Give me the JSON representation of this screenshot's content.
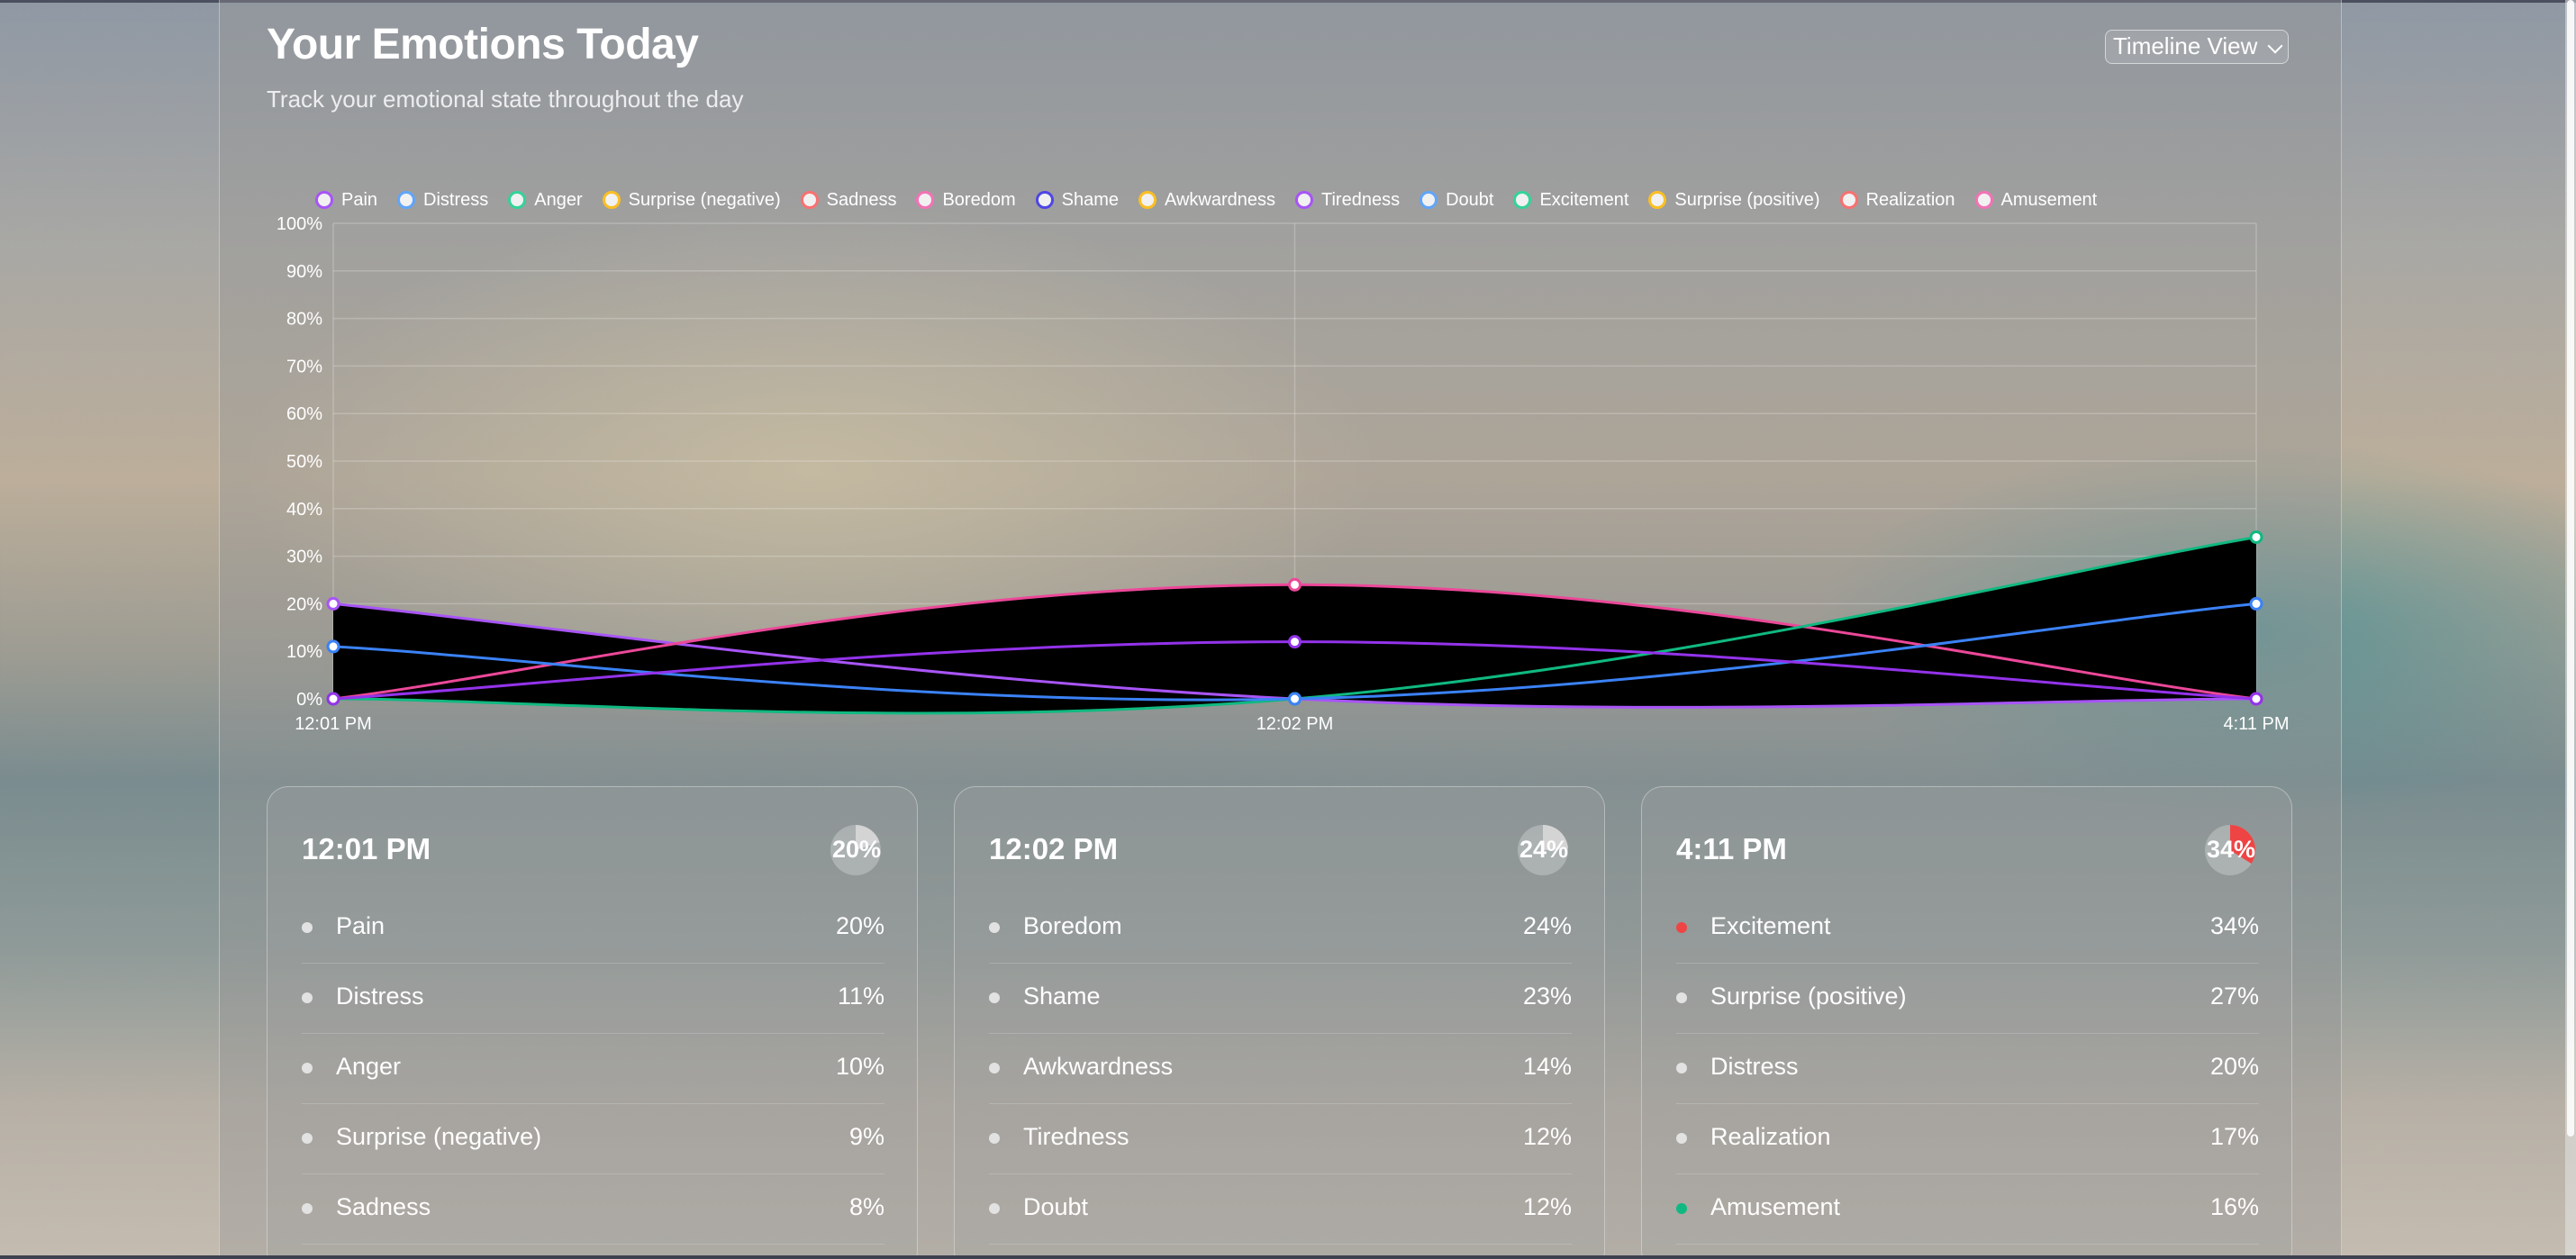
{
  "header": {
    "title": "Your Emotions Today",
    "subtitle": "Track your emotional state throughout the day",
    "view_select": "Timeline View"
  },
  "legend": [
    {
      "label": "Pain",
      "color": "#a855f7"
    },
    {
      "label": "Distress",
      "color": "#60a5fa"
    },
    {
      "label": "Anger",
      "color": "#34d399"
    },
    {
      "label": "Surprise (negative)",
      "color": "#fbbf24"
    },
    {
      "label": "Sadness",
      "color": "#f87171"
    },
    {
      "label": "Boredom",
      "color": "#f472b6"
    },
    {
      "label": "Shame",
      "color": "#4f46e5"
    },
    {
      "label": "Awkwardness",
      "color": "#fbbf24"
    },
    {
      "label": "Tiredness",
      "color": "#a855f7"
    },
    {
      "label": "Doubt",
      "color": "#60a5fa"
    },
    {
      "label": "Excitement",
      "color": "#34d399"
    },
    {
      "label": "Surprise (positive)",
      "color": "#fbbf24"
    },
    {
      "label": "Realization",
      "color": "#f87171"
    },
    {
      "label": "Amusement",
      "color": "#f472b6"
    }
  ],
  "chart_data": {
    "type": "area",
    "x": [
      "12:01 PM",
      "12:02 PM",
      "4:11 PM"
    ],
    "ylim": [
      0,
      100
    ],
    "yticks": [
      "0%",
      "10%",
      "20%",
      "30%",
      "40%",
      "50%",
      "60%",
      "70%",
      "80%",
      "90%",
      "100%"
    ],
    "grid": true,
    "legend": "top",
    "series": [
      {
        "name": "Pain",
        "values": [
          20,
          0,
          0
        ],
        "color": "#a855f7"
      },
      {
        "name": "Boredom",
        "values": [
          0,
          24,
          0
        ],
        "color": "#ec4899"
      },
      {
        "name": "Excitement",
        "values": [
          0,
          0,
          34
        ],
        "color": "#10b981"
      },
      {
        "name": "Distress",
        "values": [
          11,
          0,
          20
        ],
        "color": "#3b82f6"
      },
      {
        "name": "Tiredness",
        "values": [
          0,
          12,
          0
        ],
        "color": "#9333ea"
      }
    ]
  },
  "cards": [
    {
      "time": "12:01 PM",
      "top_pct": "20%",
      "top_value": 20,
      "pie_color": "#d4d4d4",
      "emotions": [
        {
          "name": "Pain",
          "value": "20%",
          "dot": "#e2e2e2"
        },
        {
          "name": "Distress",
          "value": "11%",
          "dot": "#e2e2e2"
        },
        {
          "name": "Anger",
          "value": "10%",
          "dot": "#e2e2e2"
        },
        {
          "name": "Surprise (negative)",
          "value": "9%",
          "dot": "#e2e2e2"
        },
        {
          "name": "Sadness",
          "value": "8%",
          "dot": "#e2e2e2"
        }
      ]
    },
    {
      "time": "12:02 PM",
      "top_pct": "24%",
      "top_value": 24,
      "pie_color": "#d4d4d4",
      "emotions": [
        {
          "name": "Boredom",
          "value": "24%",
          "dot": "#e2e2e2"
        },
        {
          "name": "Shame",
          "value": "23%",
          "dot": "#e2e2e2"
        },
        {
          "name": "Awkwardness",
          "value": "14%",
          "dot": "#e2e2e2"
        },
        {
          "name": "Tiredness",
          "value": "12%",
          "dot": "#e2e2e2"
        },
        {
          "name": "Doubt",
          "value": "12%",
          "dot": "#e2e2e2"
        }
      ]
    },
    {
      "time": "4:11 PM",
      "top_pct": "34%",
      "top_value": 34,
      "pie_color": "#ef4444",
      "emotions": [
        {
          "name": "Excitement",
          "value": "34%",
          "dot": "#ef4444"
        },
        {
          "name": "Surprise (positive)",
          "value": "27%",
          "dot": "#e2e2e2"
        },
        {
          "name": "Distress",
          "value": "20%",
          "dot": "#e2e2e2"
        },
        {
          "name": "Realization",
          "value": "17%",
          "dot": "#e2e2e2"
        },
        {
          "name": "Amusement",
          "value": "16%",
          "dot": "#10b981"
        }
      ]
    }
  ]
}
